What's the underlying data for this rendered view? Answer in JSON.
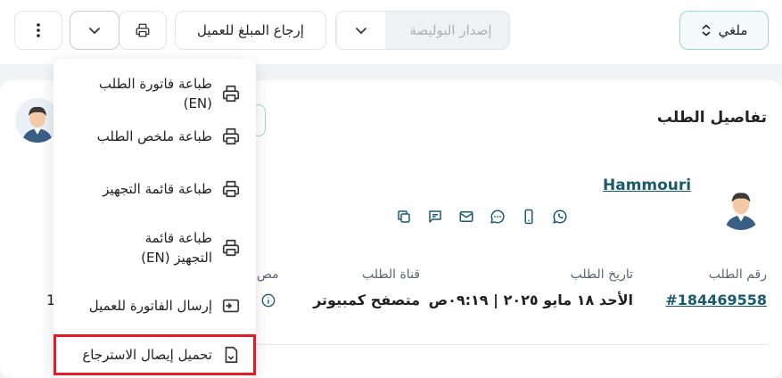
{
  "toolbar": {
    "status_label": "ملغي",
    "issue_policy_label": "إصدار البوليصة",
    "refund_label": "إرجاع المبلغ للعميل"
  },
  "order": {
    "title": "تفاصيل الطلب",
    "customer_name": "Hammouri",
    "fields": [
      {
        "label": "رقم الطلب",
        "value": "#184469558"
      },
      {
        "label": "تاريخ الطلب",
        "value": "الأحد ١٨ مايو ٢٠٢٥ | ٠٩:١٩ص"
      },
      {
        "label": "قناة الطلب",
        "value": "متصفح كمبيوتر"
      },
      {
        "label": "مص",
        "value": "1"
      }
    ]
  },
  "print_menu": {
    "items": [
      {
        "label": "طباعة فاتورة الطلب (EN)",
        "icon": "printer-icon"
      },
      {
        "label": "طباعة ملخص الطلب",
        "icon": "printer-icon"
      },
      {
        "label": "طباعة قائمة التجهيز",
        "icon": "printer-icon"
      },
      {
        "label": "طباعة قائمة التجهيز (EN)",
        "icon": "printer-icon"
      },
      {
        "label": "إرسال الفاتورة للعميل",
        "icon": "send-invoice-icon"
      },
      {
        "label": "تحميل إيصال الاسترجاع",
        "icon": "receipt-download-icon"
      }
    ]
  },
  "colors": {
    "accent": "#1a5a6e",
    "highlight": "#e11d2a",
    "status_border": "#9fd6cd"
  }
}
